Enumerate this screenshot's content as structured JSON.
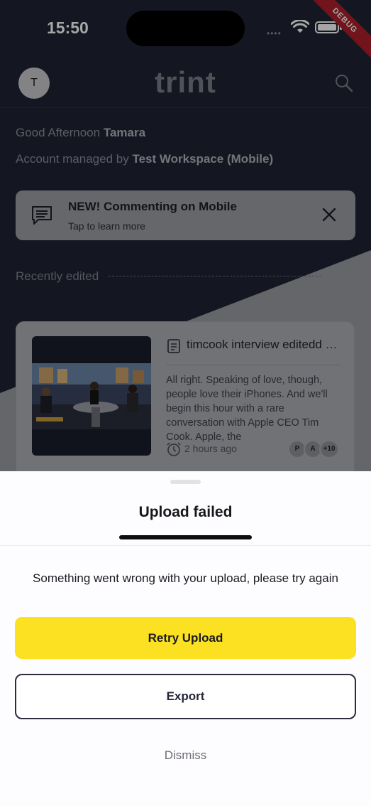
{
  "status_bar": {
    "time": "15:50",
    "signal": "••••",
    "debug_label": "DEBUG"
  },
  "header": {
    "avatar_initial": "T",
    "logo": "trint"
  },
  "greeting": {
    "prefix": "Good Afternoon",
    "name": "Tamara"
  },
  "account": {
    "prefix": "Account managed by",
    "workspace": "Test Workspace (Mobile)"
  },
  "banner": {
    "title": "NEW! Commenting on Mobile",
    "subtitle": "Tap to learn more"
  },
  "section": {
    "recently_edited": "Recently edited"
  },
  "card": {
    "title": "timcook interview editedd edited",
    "excerpt": "All right. Speaking of love, though, people love their iPhones. And we'll begin this hour with a rare conversation with Apple CEO Tim Cook. Apple, the",
    "time_ago": "2 hours ago",
    "collaborators": [
      "P",
      "A",
      "+10"
    ]
  },
  "sheet": {
    "title": "Upload failed",
    "message": "Something went wrong with your upload, please try again",
    "retry_label": "Retry Upload",
    "export_label": "Export",
    "dismiss_label": "Dismiss"
  },
  "colors": {
    "accent": "#fbe122",
    "outline": "#2b2c3e",
    "debug": "#b0202a"
  }
}
